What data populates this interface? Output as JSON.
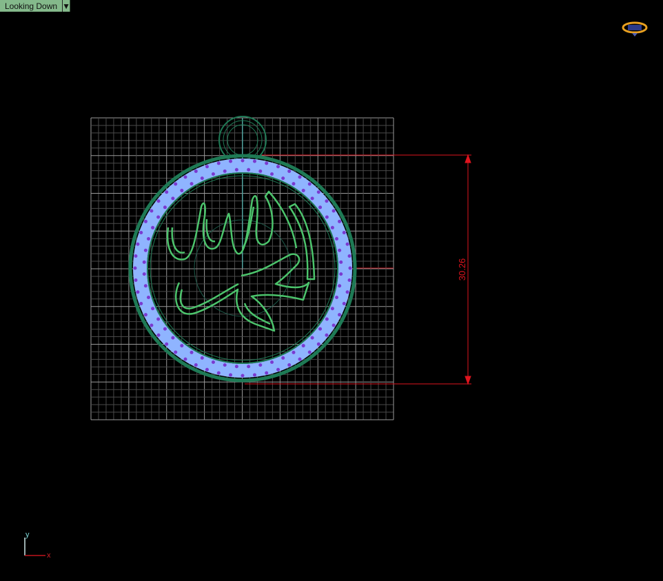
{
  "viewport": {
    "title": "Looking Down"
  },
  "dimension": {
    "value": "30.26"
  },
  "axes": {
    "x_label": "x",
    "y_label": "y"
  },
  "colors": {
    "grid": "#8a8a8a",
    "dimension": "#e0141e",
    "frame": "#1e7a55",
    "beads": "#8fb4ff",
    "bead_dots": "#7a3ad0",
    "calligraphy": "#4cc46c"
  }
}
